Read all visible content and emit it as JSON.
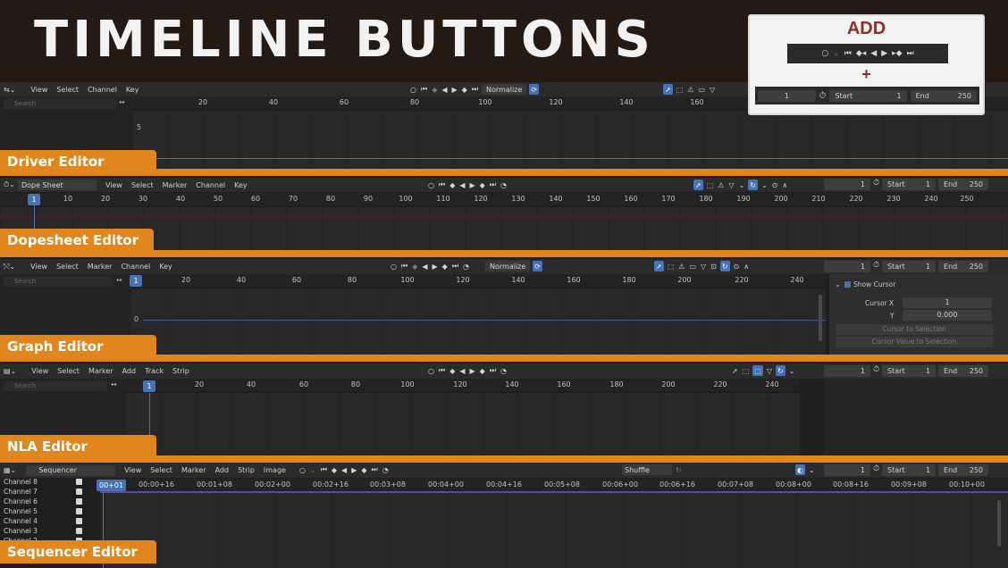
{
  "banner": {
    "title": "TIMELINE BUTTONS"
  },
  "add_box": {
    "title": "ADD",
    "plus": "+",
    "frame": "1",
    "start_label": "Start",
    "start_value": "1",
    "end_label": "End",
    "end_value": "250"
  },
  "driver": {
    "label": "Driver Editor",
    "menus": [
      "View",
      "Select",
      "Channel",
      "Key"
    ],
    "normalize": "Normalize",
    "search_placeholder": "Search",
    "ticks": [
      "20",
      "40",
      "60",
      "80",
      "100",
      "120",
      "140",
      "160"
    ],
    "y_value": "5",
    "end_value_partial": "250"
  },
  "dopesheet": {
    "label": "Dopesheet Editor",
    "mode": "Dope Sheet",
    "menus": [
      "View",
      "Select",
      "Marker",
      "Channel",
      "Key"
    ],
    "frame": "1",
    "start_label": "Start",
    "start_value": "1",
    "end_label": "End",
    "end_value": "250",
    "current_frame": "1",
    "ticks": [
      "10",
      "20",
      "30",
      "40",
      "50",
      "60",
      "70",
      "80",
      "90",
      "100",
      "110",
      "120",
      "130",
      "140",
      "150",
      "160",
      "170",
      "180",
      "190",
      "200",
      "210",
      "220",
      "230",
      "240",
      "250"
    ]
  },
  "graph": {
    "label": "Graph Editor",
    "menus": [
      "View",
      "Select",
      "Marker",
      "Channel",
      "Key"
    ],
    "normalize": "Normalize",
    "search_placeholder": "Search",
    "frame": "1",
    "start_label": "Start",
    "start_value": "1",
    "end_label": "End",
    "end_value": "250",
    "current_frame": "1",
    "ticks": [
      "20",
      "40",
      "60",
      "80",
      "100",
      "120",
      "140",
      "160",
      "180",
      "200",
      "220",
      "240"
    ],
    "y_value": "0",
    "panel": {
      "show_cursor": "Show Cursor",
      "cursor_x_label": "Cursor X",
      "cursor_x": "1",
      "y_label": "Y",
      "y": "0.000",
      "cursor_to_selection": "Cursor to Selection",
      "cursor_value_to_selection": "Cursor Value to Selection"
    }
  },
  "nla": {
    "label": "NLA Editor",
    "menus": [
      "View",
      "Select",
      "Marker",
      "Add",
      "Track",
      "Strip"
    ],
    "search_placeholder": "Search",
    "frame": "1",
    "start_label": "Start",
    "start_value": "1",
    "end_label": "End",
    "end_value": "250",
    "current_frame": "1",
    "ticks": [
      "20",
      "40",
      "60",
      "80",
      "100",
      "120",
      "140",
      "160",
      "180",
      "200",
      "220",
      "240"
    ]
  },
  "sequencer": {
    "label": "Sequencer Editor",
    "mode": "Sequencer",
    "menus": [
      "View",
      "Select",
      "Marker",
      "Add",
      "Strip",
      "Image"
    ],
    "shuffle": "Shuffle",
    "frame": "1",
    "start_label": "Start",
    "start_value": "1",
    "end_label": "End",
    "end_value": "250",
    "current_time": "00+01",
    "ticks": [
      "00:00+16",
      "00:01+08",
      "00:02+00",
      "00:02+16",
      "00:03+08",
      "00:04+00",
      "00:04+16",
      "00:05+08",
      "00:06+00",
      "00:06+16",
      "00:07+08",
      "00:08+00",
      "00:08+16",
      "00:09+08",
      "00:10+00"
    ],
    "channels": [
      "Channel 8",
      "Channel 7",
      "Channel 6",
      "Channel 5",
      "Channel 4",
      "Channel 3",
      "Channel 2"
    ]
  },
  "colors": {
    "accent_orange": "#e0861c",
    "blender_blue": "#4772b3",
    "add_red": "#8a3129"
  }
}
